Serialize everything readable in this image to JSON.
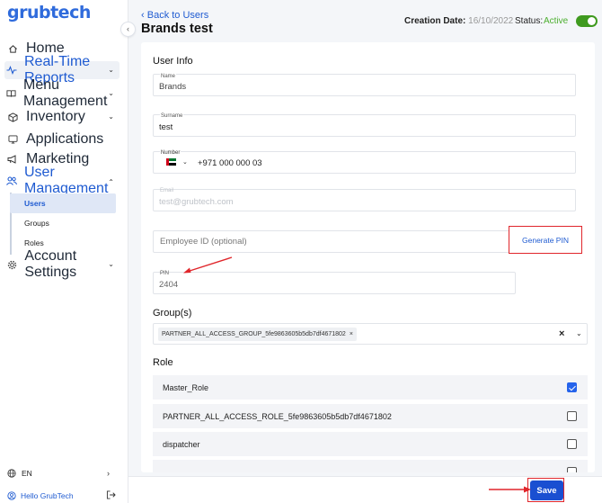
{
  "brand": {
    "logo_text": "grubtech"
  },
  "sidebar": {
    "items": [
      {
        "label": "Home",
        "icon": "home-icon"
      },
      {
        "label": "Real-Time Reports",
        "icon": "pulse-icon"
      },
      {
        "label": "Menu Management",
        "icon": "book-icon"
      },
      {
        "label": "Inventory",
        "icon": "box-icon"
      },
      {
        "label": "Applications",
        "icon": "monitor-icon"
      },
      {
        "label": "Marketing",
        "icon": "megaphone-icon"
      },
      {
        "label": "User Management",
        "icon": "users-icon"
      },
      {
        "label": "Account Settings",
        "icon": "gear-icon"
      }
    ],
    "sub_items": [
      {
        "label": "Users",
        "active": true
      },
      {
        "label": "Groups"
      },
      {
        "label": "Roles"
      }
    ],
    "language": "EN",
    "user_label": "Hello GrubTech"
  },
  "header": {
    "back_label": "Back to Users",
    "title": "Brands test",
    "creation_label": "Creation Date:",
    "creation_value": "16/10/2022",
    "status_label": "Status:",
    "status_value": "Active"
  },
  "user_info": {
    "section_title": "User Info",
    "name": {
      "label": "Name",
      "value": "Brands"
    },
    "surname": {
      "label": "Surname",
      "value": "test"
    },
    "number": {
      "label": "Number",
      "value": "+971 000 000 03"
    },
    "email": {
      "label": "Email",
      "value": "test@grubtech.com"
    },
    "employee_id": {
      "placeholder": "Employee ID (optional)"
    },
    "pin": {
      "label": "PIN",
      "value": "2404"
    },
    "generate_pin_label": "Generate PIN"
  },
  "groups": {
    "section_title": "Group(s)",
    "chips": [
      "PARTNER_ALL_ACCESS_GROUP_5fe9863605b5db7df4671802"
    ]
  },
  "roles": {
    "section_title": "Role",
    "items": [
      {
        "label": "Master_Role",
        "checked": true
      },
      {
        "label": "PARTNER_ALL_ACCESS_ROLE_5fe9863605b5db7df4671802",
        "checked": false
      },
      {
        "label": "dispatcher",
        "checked": false
      },
      {
        "label": "",
        "checked": false
      }
    ]
  },
  "footer": {
    "save_label": "Save"
  },
  "colors": {
    "accent": "#1a4fd1",
    "status_green": "#4caf2f",
    "annotation_red": "#e0262b"
  }
}
